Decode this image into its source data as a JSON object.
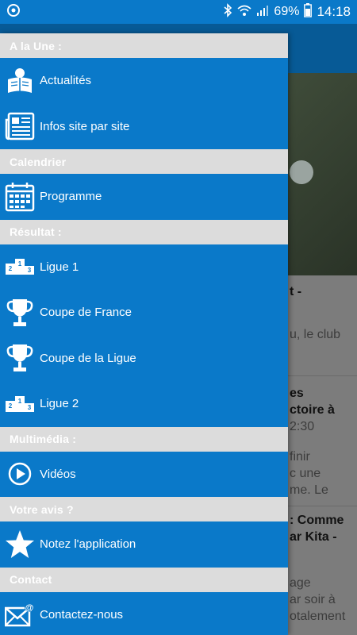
{
  "status_bar": {
    "battery": "69%",
    "time": "14:18",
    "icons": [
      "sync-icon",
      "bluetooth-icon",
      "wifi-icon",
      "signal-icon",
      "battery-icon"
    ]
  },
  "background": {
    "snippets": [
      "t -",
      "u, le club",
      "es",
      "ctoire à",
      "2:30",
      "finir",
      "c une",
      "me. Le",
      ": Comme",
      "ar Kita -",
      "age",
      "ar soir à",
      "otalement"
    ]
  },
  "drawer": {
    "sections": [
      {
        "header": "A la Une :",
        "items": [
          {
            "label": "Actualités",
            "icon": "newspaper-reader-icon"
          },
          {
            "label": "Infos site par site",
            "icon": "newspaper-icon"
          }
        ]
      },
      {
        "header": "Calendrier",
        "items": [
          {
            "label": "Programme",
            "icon": "calendar-icon"
          }
        ]
      },
      {
        "header": "Résultat :",
        "items": [
          {
            "label": "Ligue 1",
            "icon": "podium-icon"
          },
          {
            "label": "Coupe de France",
            "icon": "trophy-icon"
          },
          {
            "label": "Coupe de la Ligue",
            "icon": "trophy-icon"
          },
          {
            "label": "Ligue 2",
            "icon": "podium-icon"
          }
        ]
      },
      {
        "header": "Multimédia :",
        "items": [
          {
            "label": "Vidéos",
            "icon": "play-icon"
          }
        ]
      },
      {
        "header": "Votre avis ?",
        "items": [
          {
            "label": "Notez l'application",
            "icon": "star-icon"
          }
        ]
      },
      {
        "header": "Contact",
        "items": [
          {
            "label": "Contactez-nous",
            "icon": "mail-icon"
          }
        ]
      }
    ]
  },
  "colors": {
    "primary": "#0a79c9",
    "section_header": "#dcdcdc"
  }
}
